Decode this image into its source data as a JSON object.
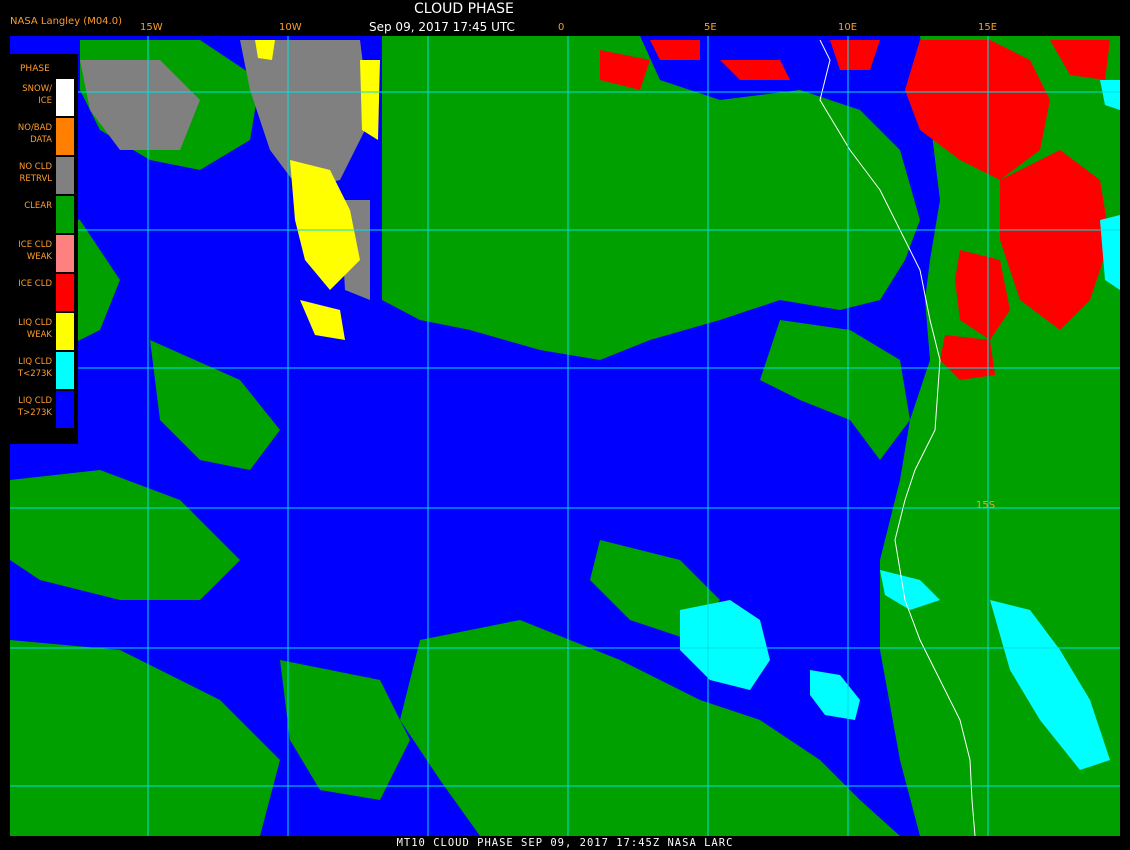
{
  "header": {
    "credit": "NASA Langley (M04.0)",
    "title": "CLOUD PHASE",
    "datetime": "Sep 09, 2017 17:45 UTC"
  },
  "footer": {
    "caption": "MT10  CLOUD PHASE  SEP 09, 2017 17:45Z  NASA LARC"
  },
  "legend": {
    "title": "PHASE",
    "items": [
      {
        "label": "SNOW/\nICE",
        "color": "#ffffff"
      },
      {
        "label": "NO/BAD\nDATA",
        "color": "#ff8000"
      },
      {
        "label": "NO CLD\nRETRVL",
        "color": "#808080"
      },
      {
        "label": "CLEAR",
        "color": "#00a000"
      },
      {
        "label": "ICE CLD\nWEAK",
        "color": "#ff8080"
      },
      {
        "label": "ICE CLD",
        "color": "#ff0000"
      },
      {
        "label": "LIQ CLD\nWEAK",
        "color": "#ffff00"
      },
      {
        "label": "LIQ CLD\nT<273K",
        "color": "#00ffff"
      },
      {
        "label": "LIQ CLD\nT>273K",
        "color": "#0000ff"
      }
    ]
  },
  "map": {
    "longitude_labels": [
      "15W",
      "10W",
      "0",
      "5E",
      "10E",
      "15E"
    ],
    "latitude_labels": [
      "15S"
    ],
    "colors": {
      "ocean_liquid": "#0000ff",
      "clear": "#00a000",
      "ice": "#ff0000",
      "liquid_cold": "#00ffff",
      "liquid_weak": "#ffff00",
      "no_retrieval": "#808080",
      "grid": "#00e0e0",
      "coast": "#ffffff"
    }
  }
}
